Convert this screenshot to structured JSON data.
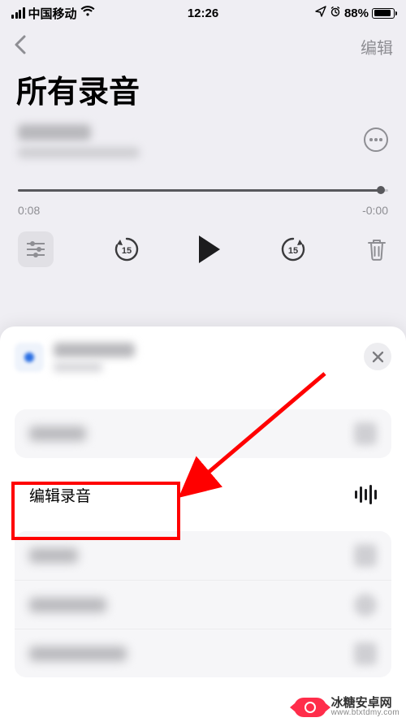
{
  "status": {
    "carrier": "中国移动",
    "time": "12:26",
    "battery_percent": "88%",
    "battery_fill_pct": 88
  },
  "nav": {
    "edit_label": "编辑"
  },
  "page": {
    "title": "所有录音"
  },
  "player": {
    "elapsed": "0:08",
    "remaining": "-0:00",
    "progress_pct": 98,
    "skip_back_seconds": "15",
    "skip_fwd_seconds": "15"
  },
  "sheet": {
    "edit_recording_label": "编辑录音"
  },
  "watermark": {
    "name": "冰糖安卓网",
    "url": "www.btxtdmy.com"
  }
}
